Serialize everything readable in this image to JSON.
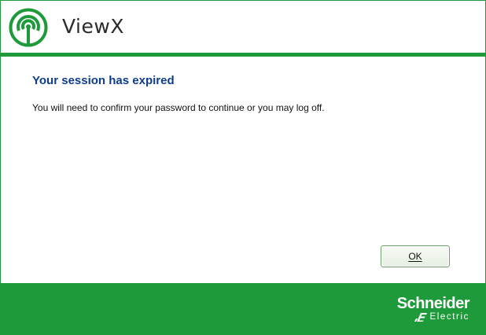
{
  "header": {
    "app_title": "ViewX",
    "logo_icon": "wireless-signal-icon"
  },
  "dialog": {
    "title": "Your session has expired",
    "message": "You will need to confirm your password to continue or you may log off.",
    "ok_label": "OK"
  },
  "footer": {
    "brand_name": "Schneider",
    "brand_sub": "Electric",
    "brand_icon": "schneider-electric-mark-icon"
  },
  "colors": {
    "brand_green": "#1f9a3a",
    "title_blue": "#0e3d8c"
  }
}
